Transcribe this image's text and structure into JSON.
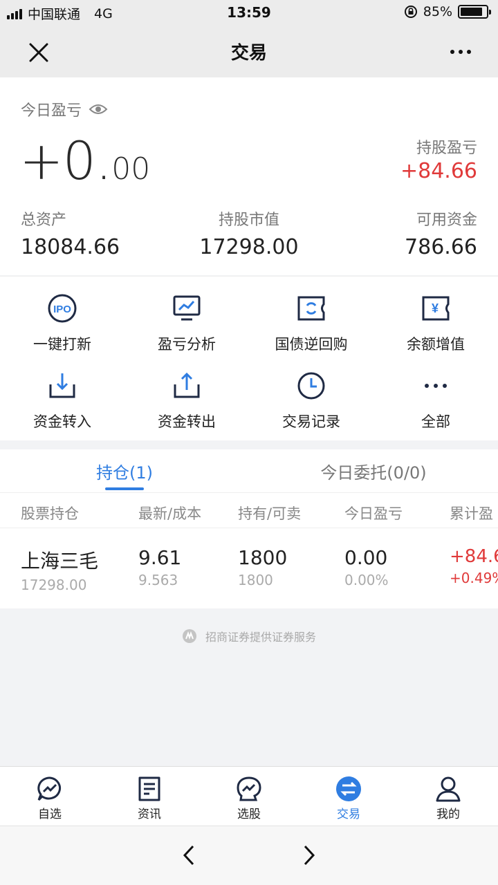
{
  "status": {
    "carrier": "中国联通",
    "network": "4G",
    "time": "13:59",
    "battery": "85%"
  },
  "nav": {
    "title": "交易"
  },
  "summary": {
    "today_label": "今日盈亏",
    "today_value_int": "+0.",
    "today_value_dec": "00",
    "hold_label": "持股盈亏",
    "hold_value": "+84.66",
    "assets": [
      {
        "label": "总资产",
        "value": "18084.66"
      },
      {
        "label": "持股市值",
        "value": "17298.00"
      },
      {
        "label": "可用资金",
        "value": "786.66"
      }
    ]
  },
  "actions": [
    {
      "label": "一键打新",
      "icon": "ipo-icon"
    },
    {
      "label": "盈亏分析",
      "icon": "chart-icon"
    },
    {
      "label": "国债逆回购",
      "icon": "repo-icon"
    },
    {
      "label": "余额增值",
      "icon": "yen-icon"
    },
    {
      "label": "资金转入",
      "icon": "transfer-in-icon"
    },
    {
      "label": "资金转出",
      "icon": "transfer-out-icon"
    },
    {
      "label": "交易记录",
      "icon": "clock-icon"
    },
    {
      "label": "全部",
      "icon": "more-icon"
    }
  ],
  "tabs": {
    "positions": "持仓(1)",
    "orders": "今日委托(0/0)"
  },
  "table": {
    "headers": [
      "股票持仓",
      "最新/成本",
      "持有/可卖",
      "今日盈亏",
      "累计盈"
    ],
    "rows": [
      {
        "name": "上海三毛",
        "market_value": "17298.00",
        "latest": "9.61",
        "cost": "9.563",
        "held": "1800",
        "sellable": "1800",
        "today_pl": "0.00",
        "today_pct": "0.00%",
        "total_pl": "+84.6",
        "total_pct": "+0.49%"
      }
    ]
  },
  "footer": {
    "note": "招商证券提供证券服务"
  },
  "tabbar": [
    {
      "label": "自选",
      "icon": "watchlist-icon"
    },
    {
      "label": "资讯",
      "icon": "news-icon"
    },
    {
      "label": "选股",
      "icon": "stock-pick-icon"
    },
    {
      "label": "交易",
      "icon": "trade-icon",
      "active": true
    },
    {
      "label": "我的",
      "icon": "profile-icon"
    }
  ],
  "colors": {
    "accent": "#2f7de1",
    "up": "#e03a3a",
    "text": "#222222",
    "muted": "#777777"
  }
}
